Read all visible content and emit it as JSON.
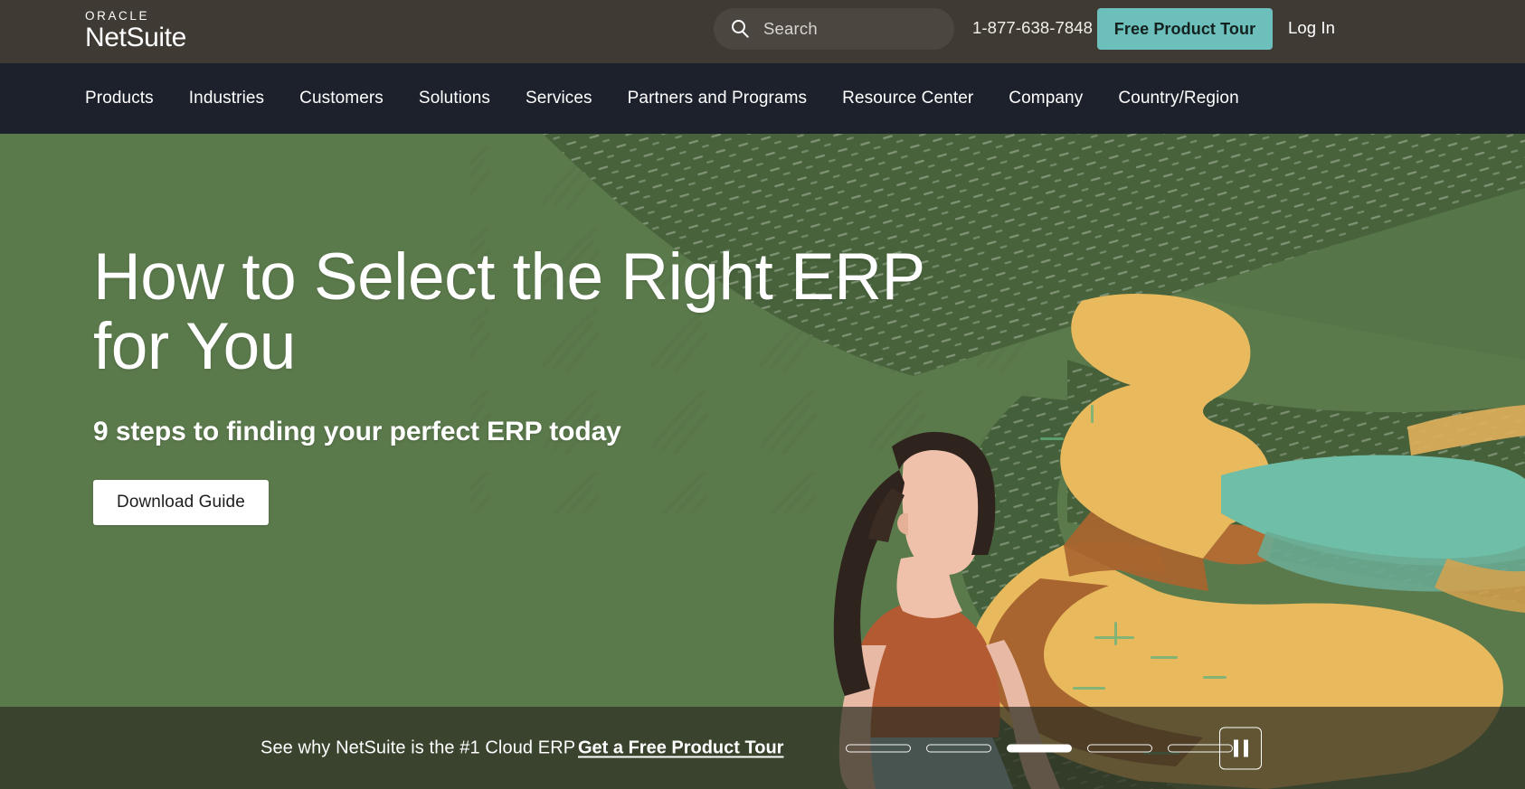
{
  "topbar": {
    "logo_oracle": "ORACLE",
    "logo_netsuite": "NetSuite",
    "search_placeholder": "Search",
    "search_value": "",
    "search_icon": "search-icon",
    "phone": "1-877-638-7848",
    "tour_button": "Free Product Tour",
    "login": "Log In",
    "bg_color": "#3f3a34",
    "accent_color": "#6cbfbb"
  },
  "nav": {
    "bg_color": "#1c212b",
    "items": [
      {
        "label": "Products"
      },
      {
        "label": "Industries"
      },
      {
        "label": "Customers"
      },
      {
        "label": "Solutions"
      },
      {
        "label": "Services"
      },
      {
        "label": "Partners and Programs"
      },
      {
        "label": "Resource Center"
      },
      {
        "label": "Company"
      },
      {
        "label": "Country/Region"
      }
    ]
  },
  "hero": {
    "title": "How to Select the Right ERP for You",
    "subtitle": "9 steps to finding your perfect ERP today",
    "cta_label": "Download Guide",
    "bg_color": "#5b7a4c",
    "illustration": "woman-walking-winding-path-illustration"
  },
  "promo": {
    "text": "See why NetSuite is the #1 Cloud ERP",
    "link_label": "Get a Free Product Tour",
    "slide_count": 5,
    "active_slide": 3,
    "pause_icon": "pause-icon",
    "bg_color": "#2c2e22"
  }
}
